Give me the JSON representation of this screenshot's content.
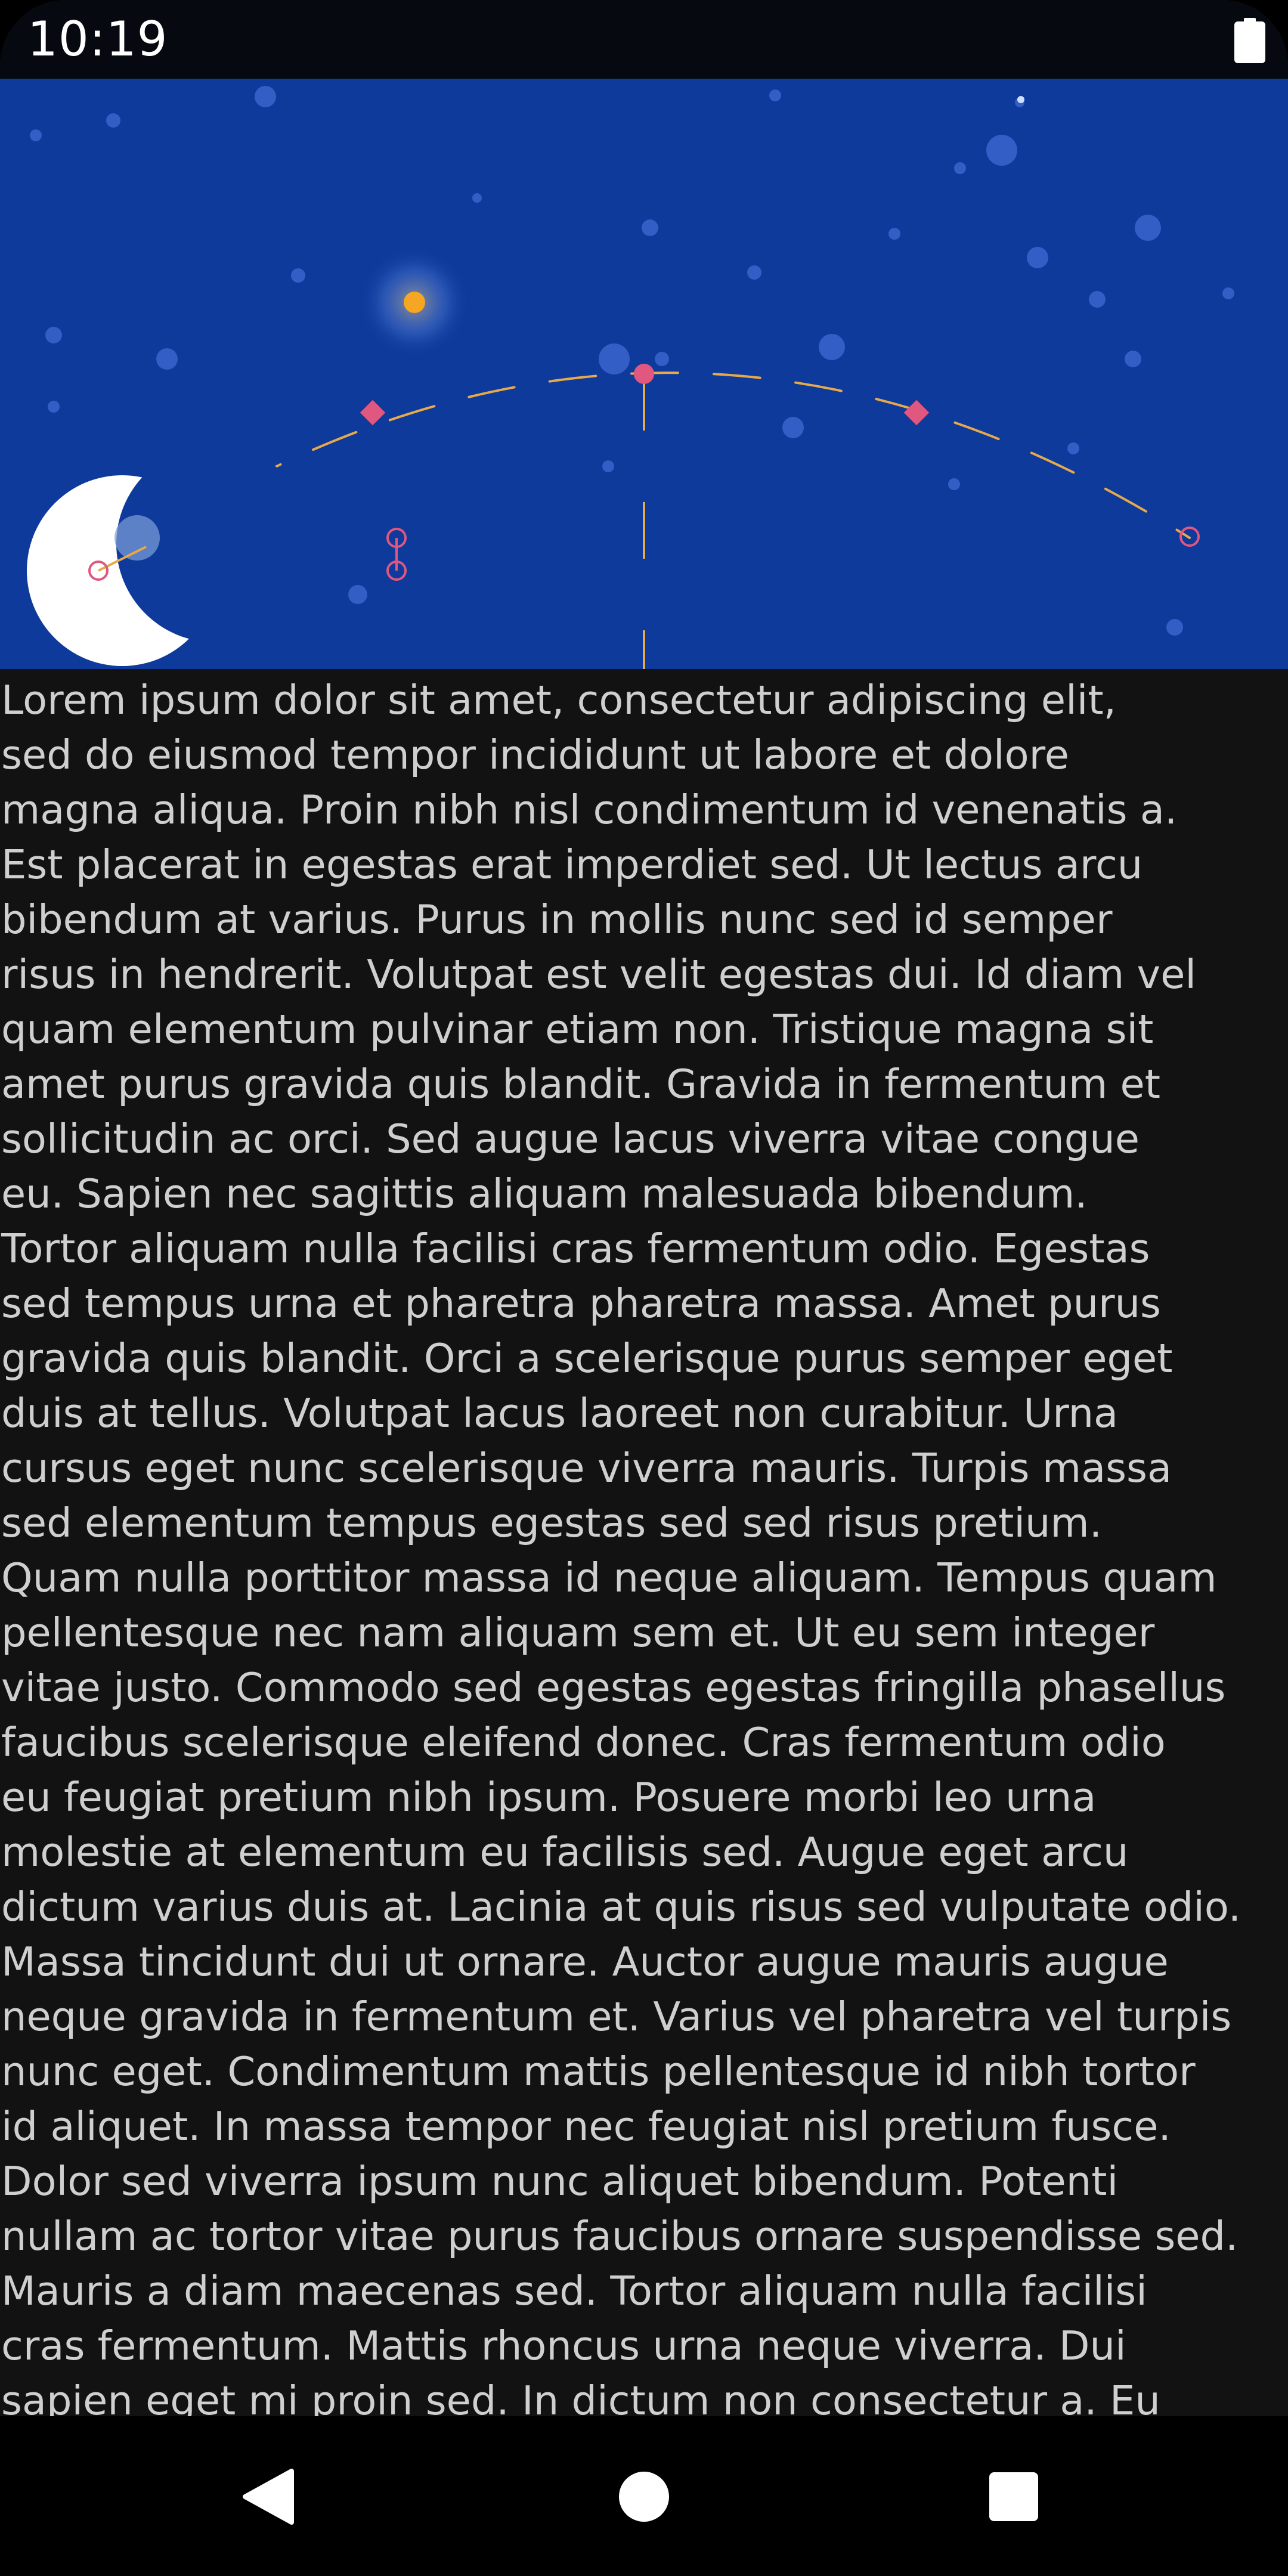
{
  "status_bar": {
    "time": "10:19",
    "battery_icon": "battery-full-icon"
  },
  "header": {
    "scene": "night-sky-moon-arc",
    "colors": {
      "sky": "#0d3a9b",
      "moon": "#ffffff",
      "sun": "#f5a623",
      "arc": "#e8a94a",
      "marker": "#e0577f"
    }
  },
  "article": {
    "text": "Lorem ipsum dolor sit amet, consectetur adipiscing elit,\nsed do eiusmod tempor incididunt ut labore et dolore\nmagna aliqua. Proin nibh nisl condimentum id venenatis a.\nEst placerat in egestas erat imperdiet sed. Ut lectus arcu\nbibendum at varius. Purus in mollis nunc sed id semper\nrisus in hendrerit. Volutpat est velit egestas dui. Id diam vel\nquam elementum pulvinar etiam non. Tristique magna sit\namet purus gravida quis blandit. Gravida in fermentum et\nsollicitudin ac orci. Sed augue lacus viverra vitae congue\neu. Sapien nec sagittis aliquam malesuada bibendum.\nTortor aliquam nulla facilisi cras fermentum odio. Egestas\nsed tempus urna et pharetra pharetra massa. Amet purus\ngravida quis blandit. Orci a scelerisque purus semper eget\nduis at tellus. Volutpat lacus laoreet non curabitur. Urna\ncursus eget nunc scelerisque viverra mauris. Turpis massa\nsed elementum tempus egestas sed sed risus pretium.\nQuam nulla porttitor massa id neque aliquam. Tempus quam\npellentesque nec nam aliquam sem et. Ut eu sem integer\nvitae justo. Commodo sed egestas egestas fringilla phasellus\nfaucibus scelerisque eleifend donec. Cras fermentum odio\neu feugiat pretium nibh ipsum. Posuere morbi leo urna\nmolestie at elementum eu facilisis sed. Augue eget arcu\ndictum varius duis at. Lacinia at quis risus sed vulputate odio.\nMassa tincidunt dui ut ornare. Auctor augue mauris augue\nneque gravida in fermentum et. Varius vel pharetra vel turpis\nnunc eget. Condimentum mattis pellentesque id nibh tortor\nid aliquet. In massa tempor nec feugiat nisl pretium fusce.\nDolor sed viverra ipsum nunc aliquet bibendum. Potenti\nnullam ac tortor vitae purus faucibus ornare suspendisse sed.\nMauris a diam maecenas sed. Tortor aliquam nulla facilisi\ncras fermentum. Mattis rhoncus urna neque viverra. Dui\nsapien eget mi proin sed. In dictum non consectetur a. Eu"
  },
  "nav_bar": {
    "back_icon": "back-triangle-icon",
    "home_icon": "home-circle-icon",
    "recents_icon": "recents-square-icon"
  }
}
